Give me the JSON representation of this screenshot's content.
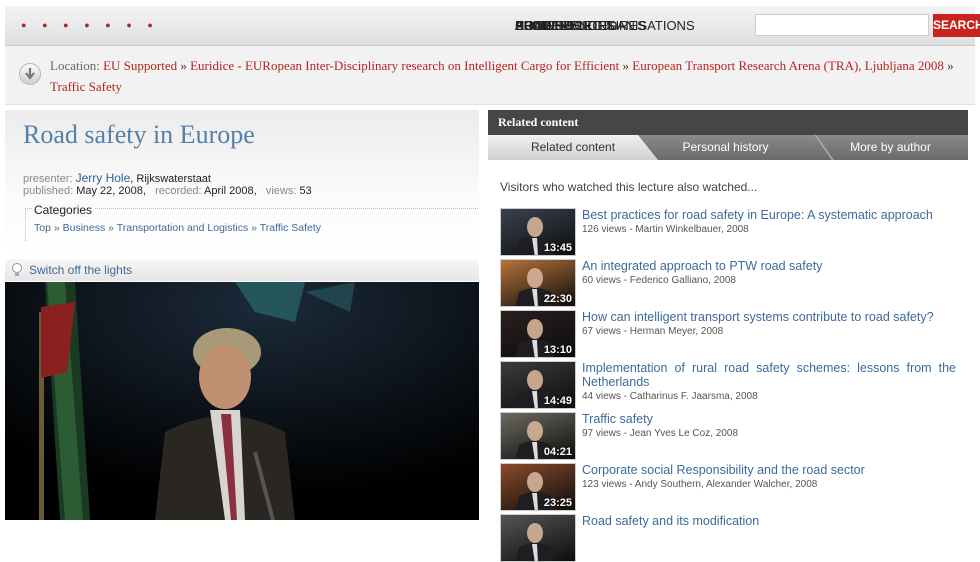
{
  "nav": {
    "items": [
      "HOME",
      "BROWSE LECTURES",
      "PEOPLE",
      "CONFERENCES",
      "ACADEMIC ORGANISATIONS",
      "EU SUPPORTED",
      "BLOG",
      "ABOUT US"
    ],
    "search_placeholder": "",
    "search_label": "SEARCH"
  },
  "location": {
    "label": "Location:",
    "crumbs": [
      "EU Supported",
      "Euridice - EURopean Inter-Disciplinary research on Intelligent Cargo for Efficient",
      "European Transport Research Arena (TRA), Ljubljana 2008",
      "Traffic Safety"
    ],
    "separator": "»"
  },
  "lecture": {
    "title": "Road safety in Europe",
    "presenter_label": "presenter:",
    "presenter": "Jerry Hole",
    "organisation": "Rijkswaterstaat",
    "published_label": "published:",
    "published": "May 22, 2008,",
    "recorded_label": "recorded:",
    "recorded": "April 2008,",
    "views_label": "views:",
    "views": "53",
    "categories_title": "Categories",
    "categories": [
      "Top",
      "Business",
      "Transportation and Logistics",
      "Traffic Safety"
    ]
  },
  "lights": {
    "label": "Switch off the lights"
  },
  "related": {
    "header": "Related content",
    "tabs": [
      "Related content",
      "Personal history",
      "More by author"
    ],
    "active_tab": "Related content",
    "intro": "Visitors who watched this lecture also watched...",
    "items": [
      {
        "title": "Best practices for road safety in Europe: A systematic approach",
        "meta": "126 views - Martin Winkelbauer, 2008",
        "duration": "13:45",
        "thumb_color": "#3a4250"
      },
      {
        "title": "An integrated approach to PTW road safety",
        "meta": "60 views - Federico Galliano, 2008",
        "duration": "22:30",
        "thumb_color": "#b8733a"
      },
      {
        "title": "How can intelligent transport systems contribute to road safety?",
        "meta": "67 views - Herman Meyer, 2008",
        "duration": "13:10",
        "thumb_color": "#2a1f1f"
      },
      {
        "title": "Implementation of rural road safety schemes: lessons from the Netherlands",
        "meta": "44 views - Catharinus F. Jaarsma, 2008",
        "duration": "14:49",
        "thumb_color": "#3b3b3b"
      },
      {
        "title": "Traffic safety",
        "meta": "97 views - Jean Yves Le Coz, 2008",
        "duration": "04:21",
        "thumb_color": "#6c6a60"
      },
      {
        "title": "Corporate social Responsibility and the road sector",
        "meta": "123 views - Andy Southern, Alexander Walcher, 2008",
        "duration": "23:25",
        "thumb_color": "#8a4a2a"
      },
      {
        "title": "Road safety and its modification",
        "meta": "",
        "duration": "",
        "thumb_color": "#555555"
      }
    ]
  }
}
